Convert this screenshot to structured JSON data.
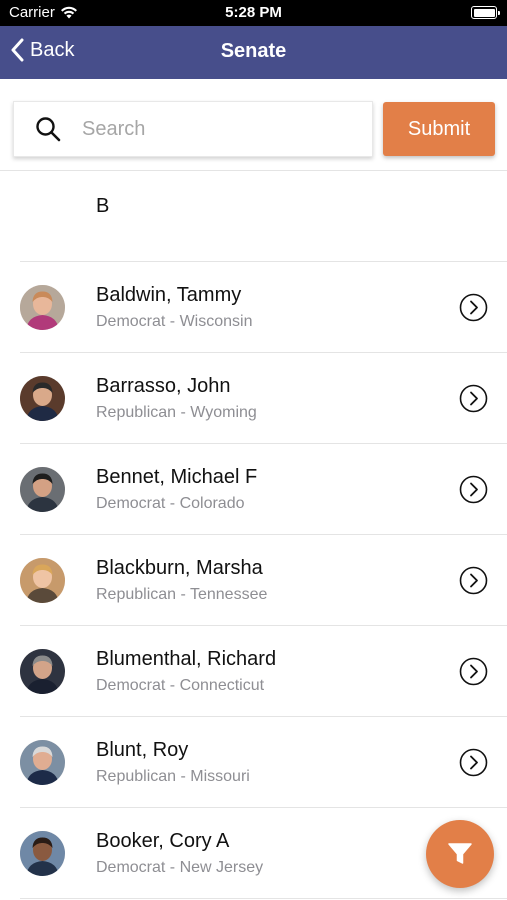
{
  "status_bar": {
    "carrier": "Carrier",
    "time": "5:28 PM"
  },
  "nav": {
    "back_label": "Back",
    "title": "Senate"
  },
  "search": {
    "placeholder": "Search",
    "value": "",
    "submit_label": "Submit"
  },
  "section": {
    "letter": "B"
  },
  "senators": [
    {
      "name": "Baldwin, Tammy",
      "detail": "Democrat - Wisconsin",
      "avatar": {
        "bg": "#b6a89a",
        "hair": "#c98a5a",
        "skin": "#e8b79a",
        "shirt": "#b13a7a"
      }
    },
    {
      "name": "Barrasso, John",
      "detail": "Republican - Wyoming",
      "avatar": {
        "bg": "#5a3b2c",
        "hair": "#2a2a2a",
        "skin": "#d9a98a",
        "shirt": "#1f2a44"
      }
    },
    {
      "name": "Bennet, Michael F",
      "detail": "Democrat - Colorado",
      "avatar": {
        "bg": "#6a6e73",
        "hair": "#1e1e1e",
        "skin": "#d4a184",
        "shirt": "#2c3440"
      }
    },
    {
      "name": "Blackburn, Marsha",
      "detail": "Republican - Tennessee",
      "avatar": {
        "bg": "#c79a6b",
        "hair": "#d9a65a",
        "skin": "#efc4a4",
        "shirt": "#5a4a3a"
      }
    },
    {
      "name": "Blumenthal, Richard",
      "detail": "Democrat - Connecticut",
      "avatar": {
        "bg": "#2e3340",
        "hair": "#8a8a8a",
        "skin": "#d3a489",
        "shirt": "#1a2030"
      }
    },
    {
      "name": "Blunt, Roy",
      "detail": "Republican - Missouri",
      "avatar": {
        "bg": "#7c8fa3",
        "hair": "#d9d9d9",
        "skin": "#e0ad92",
        "shirt": "#1d2b48"
      }
    },
    {
      "name": "Booker, Cory A",
      "detail": "Democrat - New Jersey",
      "avatar": {
        "bg": "#6f88a6",
        "hair": "#2a1c16",
        "skin": "#8a5a40",
        "shirt": "#23324a"
      }
    }
  ],
  "icons": {
    "back": "chevron-left-icon",
    "search": "magnifier-icon",
    "row_action": "chevron-right-circle-icon",
    "fab": "filter-icon"
  },
  "colors": {
    "nav": "#474e8b",
    "accent": "#e27f48"
  }
}
